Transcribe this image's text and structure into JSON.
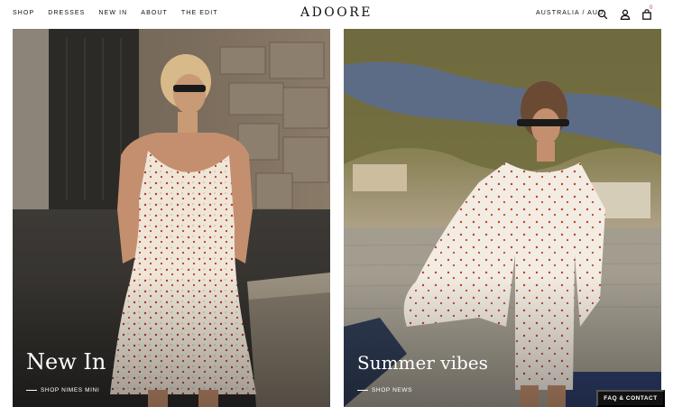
{
  "header": {
    "nav": [
      {
        "label": "SHOP"
      },
      {
        "label": "DRESSES"
      },
      {
        "label": "NEW IN"
      },
      {
        "label": "ABOUT"
      },
      {
        "label": "THE EDIT"
      }
    ],
    "logo": "ADOORE",
    "locale": "AUSTRALIA / AUD",
    "cart_count": "0",
    "icons": [
      "search-icon",
      "account-icon",
      "cart-icon"
    ]
  },
  "tiles": [
    {
      "title": "New In",
      "link": "SHOP NIMES MINI"
    },
    {
      "title": "Summer vibes",
      "link": "SHOP NEWS"
    }
  ],
  "faq_button": "FAQ & CONTACT"
}
